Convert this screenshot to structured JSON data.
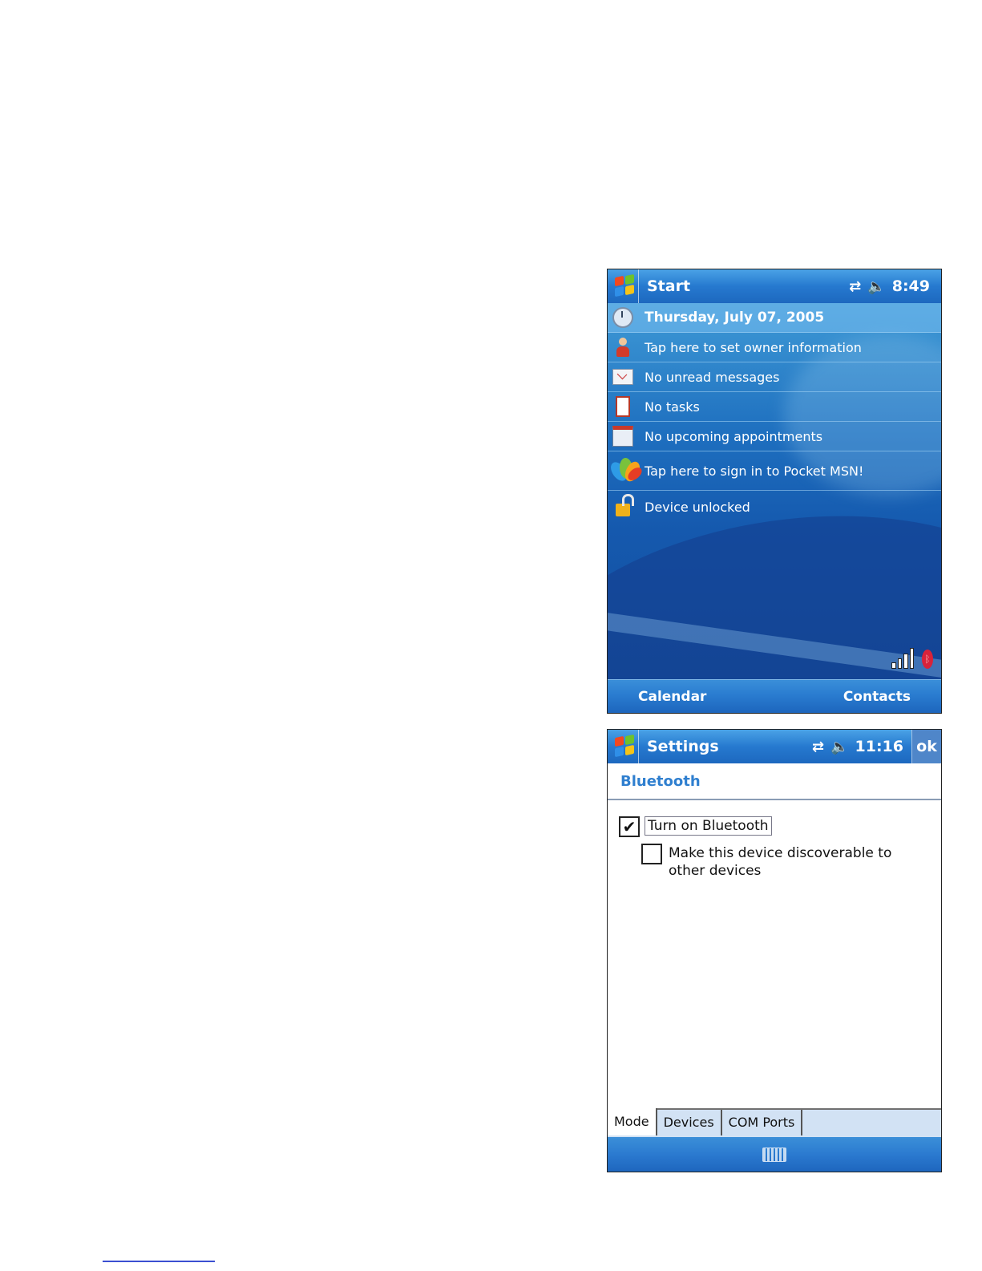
{
  "today_screen": {
    "title": "Start",
    "status_icons": [
      "sync-icon",
      "speaker-muted-icon"
    ],
    "time": "8:49",
    "items": [
      {
        "icon": "clock-icon",
        "label": "Thursday, July 07, 2005"
      },
      {
        "icon": "owner-icon",
        "label": "Tap here to set owner information"
      },
      {
        "icon": "mail-icon",
        "label": "No unread messages"
      },
      {
        "icon": "tasks-icon",
        "label": "No tasks"
      },
      {
        "icon": "calendar-icon",
        "label": "No upcoming appointments"
      },
      {
        "icon": "msn-butterfly-icon",
        "label": "Tap here to sign in to Pocket MSN!"
      },
      {
        "icon": "padlock-open-icon",
        "label": "Device unlocked"
      }
    ],
    "tray_icons": [
      "signal-strength-icon",
      "bluetooth-icon"
    ],
    "soft_keys": {
      "left": "Calendar",
      "right": "Contacts"
    }
  },
  "settings_screen": {
    "title": "Settings",
    "time": "11:16",
    "ok_label": "ok",
    "page_title": "Bluetooth",
    "options": [
      {
        "label": "Turn on Bluetooth",
        "checked": true
      },
      {
        "label": "Make this device discoverable to other devices",
        "checked": false
      }
    ],
    "tabs": [
      "Mode",
      "Devices",
      "COM Ports"
    ],
    "active_tab": "Mode",
    "input_icon": "keyboard-icon"
  },
  "colors": {
    "titlebar_blue": "#2679cf",
    "today_background": "#1a62b4",
    "page_title_blue": "#2f7fcf"
  }
}
